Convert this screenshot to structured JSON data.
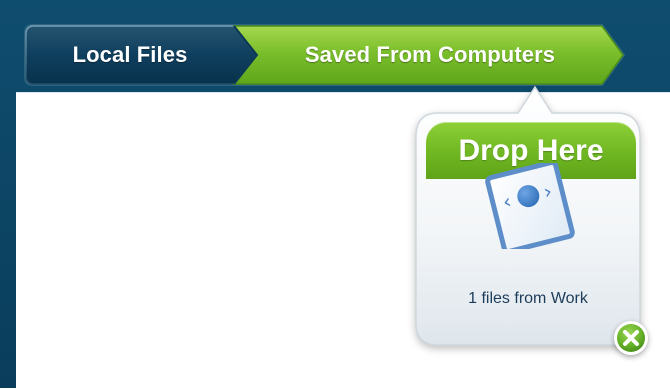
{
  "tabs": [
    {
      "label": "Local Files",
      "active": false
    },
    {
      "label": "Saved From Computers",
      "active": true
    }
  ],
  "drop_zone": {
    "title": "Drop Here",
    "file_count_text": "1 files from Work",
    "icon": "file-icon"
  },
  "colors": {
    "frame": "#0a3d5b",
    "tab_inactive": "#0d3f5e",
    "tab_active": "#72b51f",
    "drop_header": "#6fb722",
    "close_button": "#5aa51f",
    "file_icon": "#4b80c2"
  },
  "icons": {
    "close": "close-icon"
  }
}
